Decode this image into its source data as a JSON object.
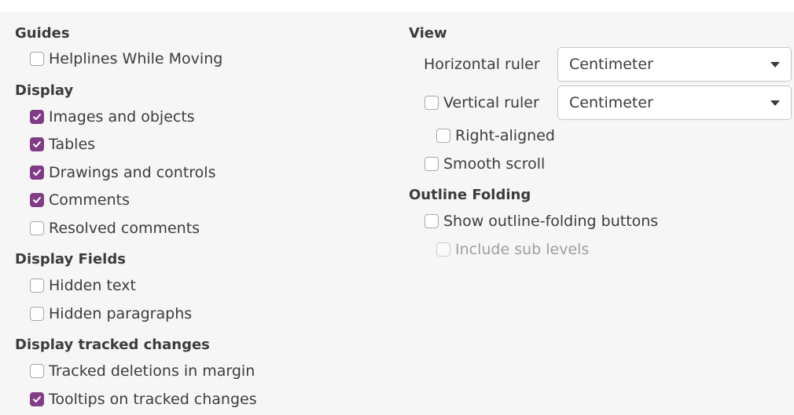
{
  "left": {
    "guides": {
      "heading": "Guides",
      "items": [
        {
          "label": "Helplines While Moving",
          "checked": false
        }
      ]
    },
    "display": {
      "heading": "Display",
      "items": [
        {
          "label": "Images and objects",
          "checked": true
        },
        {
          "label": "Tables",
          "checked": true
        },
        {
          "label": "Drawings and controls",
          "checked": true
        },
        {
          "label": "Comments",
          "checked": true
        },
        {
          "label": "Resolved comments",
          "checked": false
        }
      ]
    },
    "display_fields": {
      "heading": "Display Fields",
      "items": [
        {
          "label": "Hidden text",
          "checked": false
        },
        {
          "label": "Hidden paragraphs",
          "checked": false
        }
      ]
    },
    "tracked_changes": {
      "heading": "Display tracked changes",
      "items": [
        {
          "label": "Tracked deletions in margin",
          "checked": false
        },
        {
          "label": "Tooltips on tracked changes",
          "checked": true
        }
      ]
    }
  },
  "right": {
    "view": {
      "heading": "View",
      "horizontal_ruler_label": "Horizontal ruler",
      "horizontal_ruler_value": "Centimeter",
      "vertical_ruler": {
        "label": "Vertical ruler",
        "checked": false
      },
      "vertical_ruler_value": "Centimeter",
      "right_aligned": {
        "label": "Right-aligned",
        "checked": false
      },
      "smooth_scroll": {
        "label": "Smooth scroll",
        "checked": false
      }
    },
    "outline": {
      "heading": "Outline Folding",
      "show_buttons": {
        "label": "Show outline-folding buttons",
        "checked": false
      },
      "include_sub_levels": {
        "label": "Include sub levels",
        "checked": false,
        "disabled": true
      }
    }
  },
  "colors": {
    "accent": "#813c86",
    "panel": "#f6f6f6",
    "disabled_text": "#9e9e9e"
  }
}
